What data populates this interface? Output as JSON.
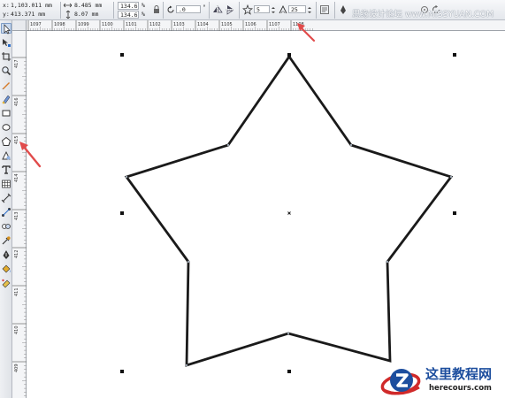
{
  "property_bar": {
    "x_label": "x:",
    "x_value": "1,103.011 mm",
    "y_label": "y:",
    "y_value": "413.371 mm",
    "width_value": "8.485 mm",
    "height_value": "8.07 mm",
    "scale_x": "134.6",
    "scale_y": "134.6",
    "percent": "%",
    "rotation_value": ".0",
    "degree": "°",
    "points_value": "5",
    "sharpness_value": "25"
  },
  "ruler_top": {
    "labels": [
      "1097",
      "1098",
      "1099",
      "1100",
      "1101",
      "1102",
      "1103",
      "1104",
      "1105",
      "1106",
      "1107",
      "1108"
    ]
  },
  "ruler_left": {
    "labels": [
      "417",
      "416",
      "415",
      "414",
      "413",
      "412",
      "411",
      "410",
      "409"
    ]
  },
  "watermark": {
    "top_text": "思缘设计论坛 www.MISSYUAN.COM",
    "site_name": "这里教程网",
    "site_url": "herecours.com"
  },
  "colors": {
    "arrow": "#e14b4b",
    "star_stroke": "#1a1a1a",
    "logo_blue": "#1d4e9e",
    "logo_red": "#d02a2a"
  },
  "icons": {
    "tools": [
      "pick-tool-icon",
      "shape-tool-icon",
      "crop-tool-icon",
      "zoom-tool-icon",
      "freehand-tool-icon",
      "smart-fill-icon",
      "rectangle-tool-icon",
      "ellipse-tool-icon",
      "polygon-tool-icon",
      "basic-shapes-icon",
      "text-tool-icon",
      "table-tool-icon",
      "dimension-tool-icon",
      "connector-tool-icon",
      "blend-tool-icon",
      "eyedropper-tool-icon",
      "outline-pen-icon",
      "fill-tool-icon",
      "interactive-fill-icon"
    ]
  }
}
